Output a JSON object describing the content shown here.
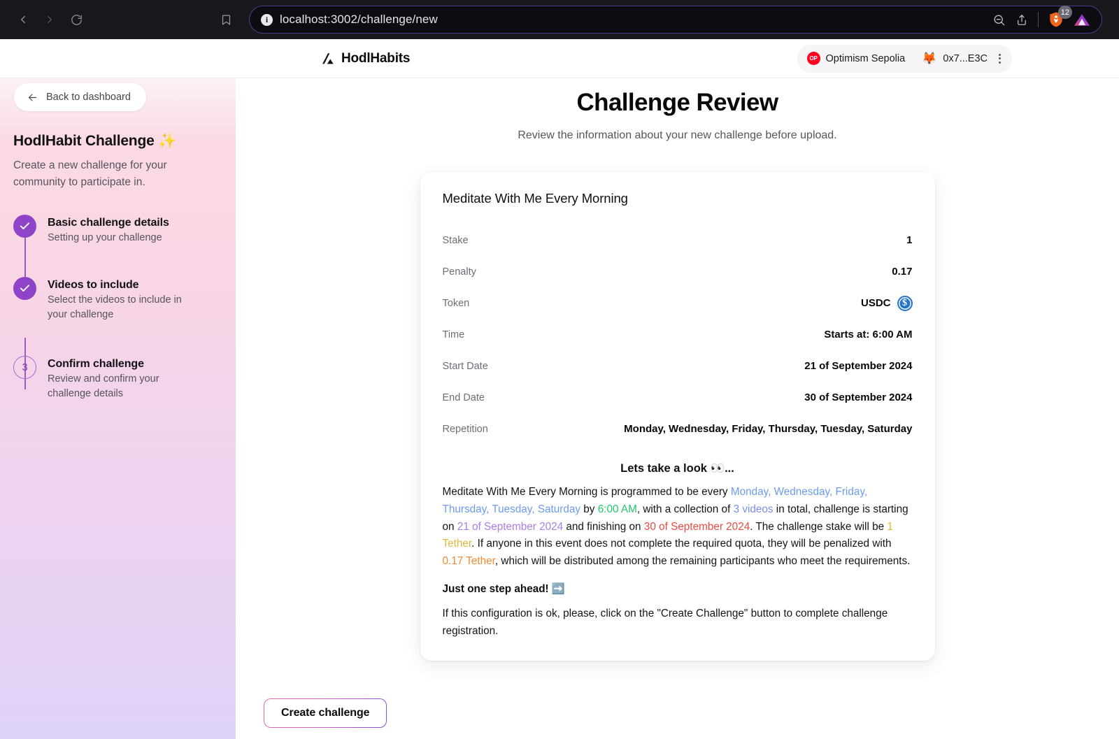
{
  "browser": {
    "url": "localhost:3002/challenge/new",
    "back_icon": "chevron-left-icon",
    "forward_icon": "chevron-right-icon",
    "reload_icon": "reload-icon",
    "bookmark_icon": "bookmark-icon",
    "info_icon": "i",
    "zoom_out_icon": "zoom-out-icon",
    "share_icon": "share-icon",
    "brave_shield_icon": "brave-lion-icon",
    "brave_badge_count": "12",
    "extension_icon": "triangle-extension-icon"
  },
  "app_header": {
    "brand_name": "HodlHabits",
    "brand_logo_icon": "slash-triangle-logo-icon",
    "chain_label": "Optimism Sepolia",
    "chain_badge_text": "OP",
    "wallet_icon": "metamask-fox-icon",
    "wallet_address": "0x7...E3C",
    "menu_icon": "kebab-menu-icon"
  },
  "sidebar": {
    "back_label": "Back to dashboard",
    "back_icon": "arrow-left-icon",
    "title": "HodlHabit Challenge ✨",
    "subtitle": "Create a new challenge for your community to participate in.",
    "steps": [
      {
        "marker": "✓",
        "state": "done",
        "title": "Basic challenge details",
        "desc": "Setting up your challenge"
      },
      {
        "marker": "✓",
        "state": "done",
        "title": "Videos to include",
        "desc": "Select the videos to include in your challenge"
      },
      {
        "marker": "3",
        "state": "current",
        "title": "Confirm challenge",
        "desc": "Review and confirm your challenge details"
      }
    ]
  },
  "main": {
    "title": "Challenge Review",
    "subtitle": "Review the information about your new challenge before upload.",
    "create_button": "Create challenge"
  },
  "card": {
    "title": "Meditate With Me Every Morning",
    "rows": [
      {
        "label": "Stake",
        "value": "1"
      },
      {
        "label": "Penalty",
        "value": "0.17"
      },
      {
        "label": "Token",
        "value": "USDC",
        "icon": "usdc-coin-icon"
      },
      {
        "label": "Time",
        "value": "Starts at: 6:00 AM"
      },
      {
        "label": "Start Date",
        "value": "21 of September 2024"
      },
      {
        "label": "End Date",
        "value": "30 of September 2024"
      },
      {
        "label": "Repetition",
        "value": "Monday, Wednesday, Friday, Thursday, Tuesday, Saturday"
      }
    ],
    "summary_heading": "Lets take a look 👀...",
    "summary": {
      "t1": "Meditate With Me Every Morning is programmed to be every ",
      "days": "Monday, Wednesday, Friday, Thursday, Tuesday, Saturday",
      "t2": " by ",
      "time": "6:00 AM",
      "t3": ", with a collection of ",
      "videos": "3 videos",
      "t4": " in total, challenge is starting on ",
      "start_date": "21 of September 2024",
      "t5": " and finishing on ",
      "end_date": "30 of September 2024",
      "t6": ". The challenge stake will be ",
      "stake": "1 Tether",
      "t7": ". If anyone in this event does not complete the required quota, they will be penalized with ",
      "penalty": "0.17 Tether",
      "t8": ", which will be distributed among the remaining participants who meet the requirements."
    },
    "next_step_heading": "Just one step ahead! ➡️",
    "closing": "If this configuration is ok, please, click on the \"Create Challenge\" button to complete challenge registration."
  },
  "colors": {
    "days": "#6c9ced",
    "time": "#27c46b",
    "videos": "#7b8fe8",
    "start_date": "#ab7de8",
    "end_date": "#ea4b43",
    "stake": "#e0b63a",
    "penalty": "#f08a2e",
    "step_accent": "#8f43c6",
    "optimism": "#ff0420",
    "usdc": "#2775ca"
  }
}
